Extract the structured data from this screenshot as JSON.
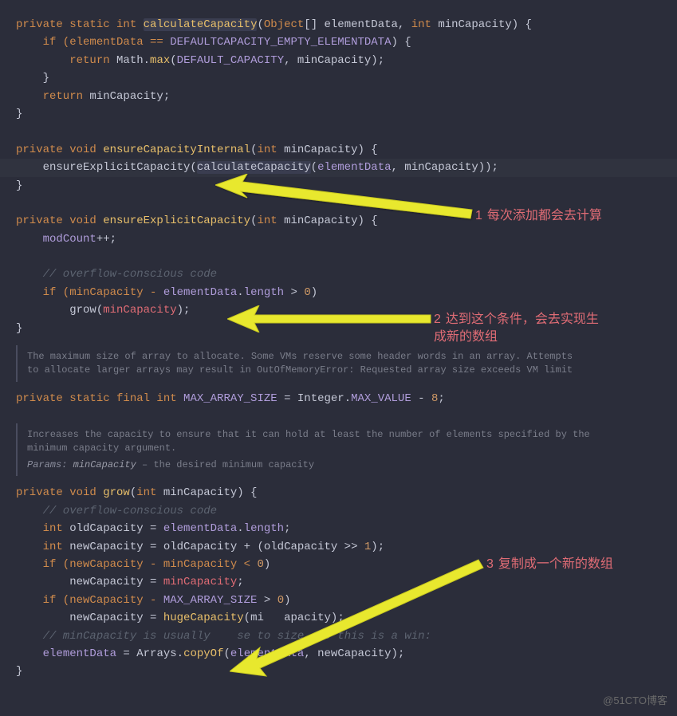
{
  "code": {
    "m1_l1_a": "private static int ",
    "m1_l1_fn": "calculateCapacity",
    "m1_l1_b": "(",
    "m1_l1_c": "Object",
    "m1_l1_d": "[] elementData, ",
    "m1_l1_e": "int ",
    "m1_l1_f": "minCapacity) {",
    "m1_l2_a": "    if (elementData == ",
    "m1_l2_b": "DEFAULTCAPACITY_EMPTY_ELEMENTDATA",
    "m1_l2_c": ") {",
    "m1_l3_a": "        return ",
    "m1_l3_b": "Math",
    "m1_l3_c": ".",
    "m1_l3_d": "max",
    "m1_l3_e": "(",
    "m1_l3_f": "DEFAULT_CAPACITY",
    "m1_l3_g": ", minCapacity);",
    "m1_l4": "    }",
    "m1_l5_a": "    return ",
    "m1_l5_b": "minCapacity;",
    "m1_l6": "}",
    "m2_l1_a": "private void ",
    "m2_l1_fn": "ensureCapacityInternal",
    "m2_l1_b": "(",
    "m2_l1_c": "int ",
    "m2_l1_d": "minCapacity) {",
    "m2_l2_a": "    ensureExplicitCapacity(",
    "m2_l2_fn": "calculateCapacity",
    "m2_l2_b": "(",
    "m2_l2_c": "elementData",
    "m2_l2_d": ", minCapacity));",
    "m2_l3": "}",
    "m3_l1_a": "private void ",
    "m3_l1_fn": "ensureExplicitCapacity",
    "m3_l1_b": "(",
    "m3_l1_c": "int ",
    "m3_l1_d": "minCapacity) {",
    "m3_l2_a": "    ",
    "m3_l2_b": "modCount",
    "m3_l2_c": "++;",
    "m3_c": "    // overflow-conscious code",
    "m3_l4_a": "    if (minCapacity - ",
    "m3_l4_b": "elementData",
    "m3_l4_c": ".",
    "m3_l4_d": "length",
    "m3_l4_e": " > ",
    "m3_l4_f": "0",
    "m3_l4_g": ")",
    "m3_l5_a": "        grow(",
    "m3_l5_b": "minCapacity",
    "m3_l5_c": ");",
    "m3_l6": "}",
    "doc1_l1": "The maximum size of array to allocate. Some VMs reserve some header words in an array. Attempts",
    "doc1_l2": "to allocate larger arrays may result in OutOfMemoryError: Requested array size exceeds VM limit",
    "f1_a": "private static final int ",
    "f1_b": "MAX_ARRAY_SIZE",
    "f1_c": " = ",
    "f1_d": "Integer",
    "f1_e": ".",
    "f1_f": "MAX_VALUE",
    "f1_g": " - ",
    "f1_h": "8",
    "f1_i": ";",
    "doc2_l1": "Increases the capacity to ensure that it can hold at least the number of elements specified by the",
    "doc2_l2": "minimum capacity argument.",
    "doc2_params_kw": "Params:",
    "doc2_params_name": "minCapacity",
    "doc2_params_desc": " – the desired minimum capacity",
    "m4_l1_a": "private void ",
    "m4_l1_fn": "grow",
    "m4_l1_b": "(",
    "m4_l1_c": "int ",
    "m4_l1_d": "minCapacity) {",
    "m4_c": "    // overflow-conscious code",
    "m4_l3_a": "    int ",
    "m4_l3_b": "oldCapacity = ",
    "m4_l3_c": "elementData",
    "m4_l3_d": ".",
    "m4_l3_e": "length",
    "m4_l3_f": ";",
    "m4_l4_a": "    int ",
    "m4_l4_b": "newCapacity = oldCapacity + (oldCapacity >> ",
    "m4_l4_c": "1",
    "m4_l4_d": ");",
    "m4_l5_a": "    if (newCapacity - minCapacity < ",
    "m4_l5_b": "0",
    "m4_l5_c": ")",
    "m4_l6_a": "        newCapacity = ",
    "m4_l6_b": "minCapacity",
    "m4_l6_c": ";",
    "m4_l7_a": "    if (newCapacity - ",
    "m4_l7_b": "MAX_ARRAY_SIZE",
    "m4_l7_c": " > ",
    "m4_l7_d": "0",
    "m4_l7_e": ")",
    "m4_l8_a": "        newCapacity = ",
    "m4_l8_b": "hugeCapacity",
    "m4_l8_c": "(mi",
    "m4_l8_d": "apacity);",
    "m4_c2_a": "    // minCapacity is usually ",
    "m4_c2_b": "se to size, so this is a win:",
    "m4_l10_a": "    ",
    "m4_l10_b": "elementData",
    "m4_l10_c": " = ",
    "m4_l10_d": "Arrays",
    "m4_l10_e": ".",
    "m4_l10_f": "copyOf",
    "m4_l10_g": "(",
    "m4_l10_h": "elementData",
    "m4_l10_i": ", newCapacity);",
    "m4_l11": "}"
  },
  "annotations": {
    "a1_num": "1",
    "a1_text": "每次添加都会去计算",
    "a2_num": "2",
    "a2_text": "达到这个条件，会去实现生成新的数组",
    "a3_num": "3",
    "a3_text": "复制成一个新的数组"
  },
  "watermark": "@51CTO博客"
}
